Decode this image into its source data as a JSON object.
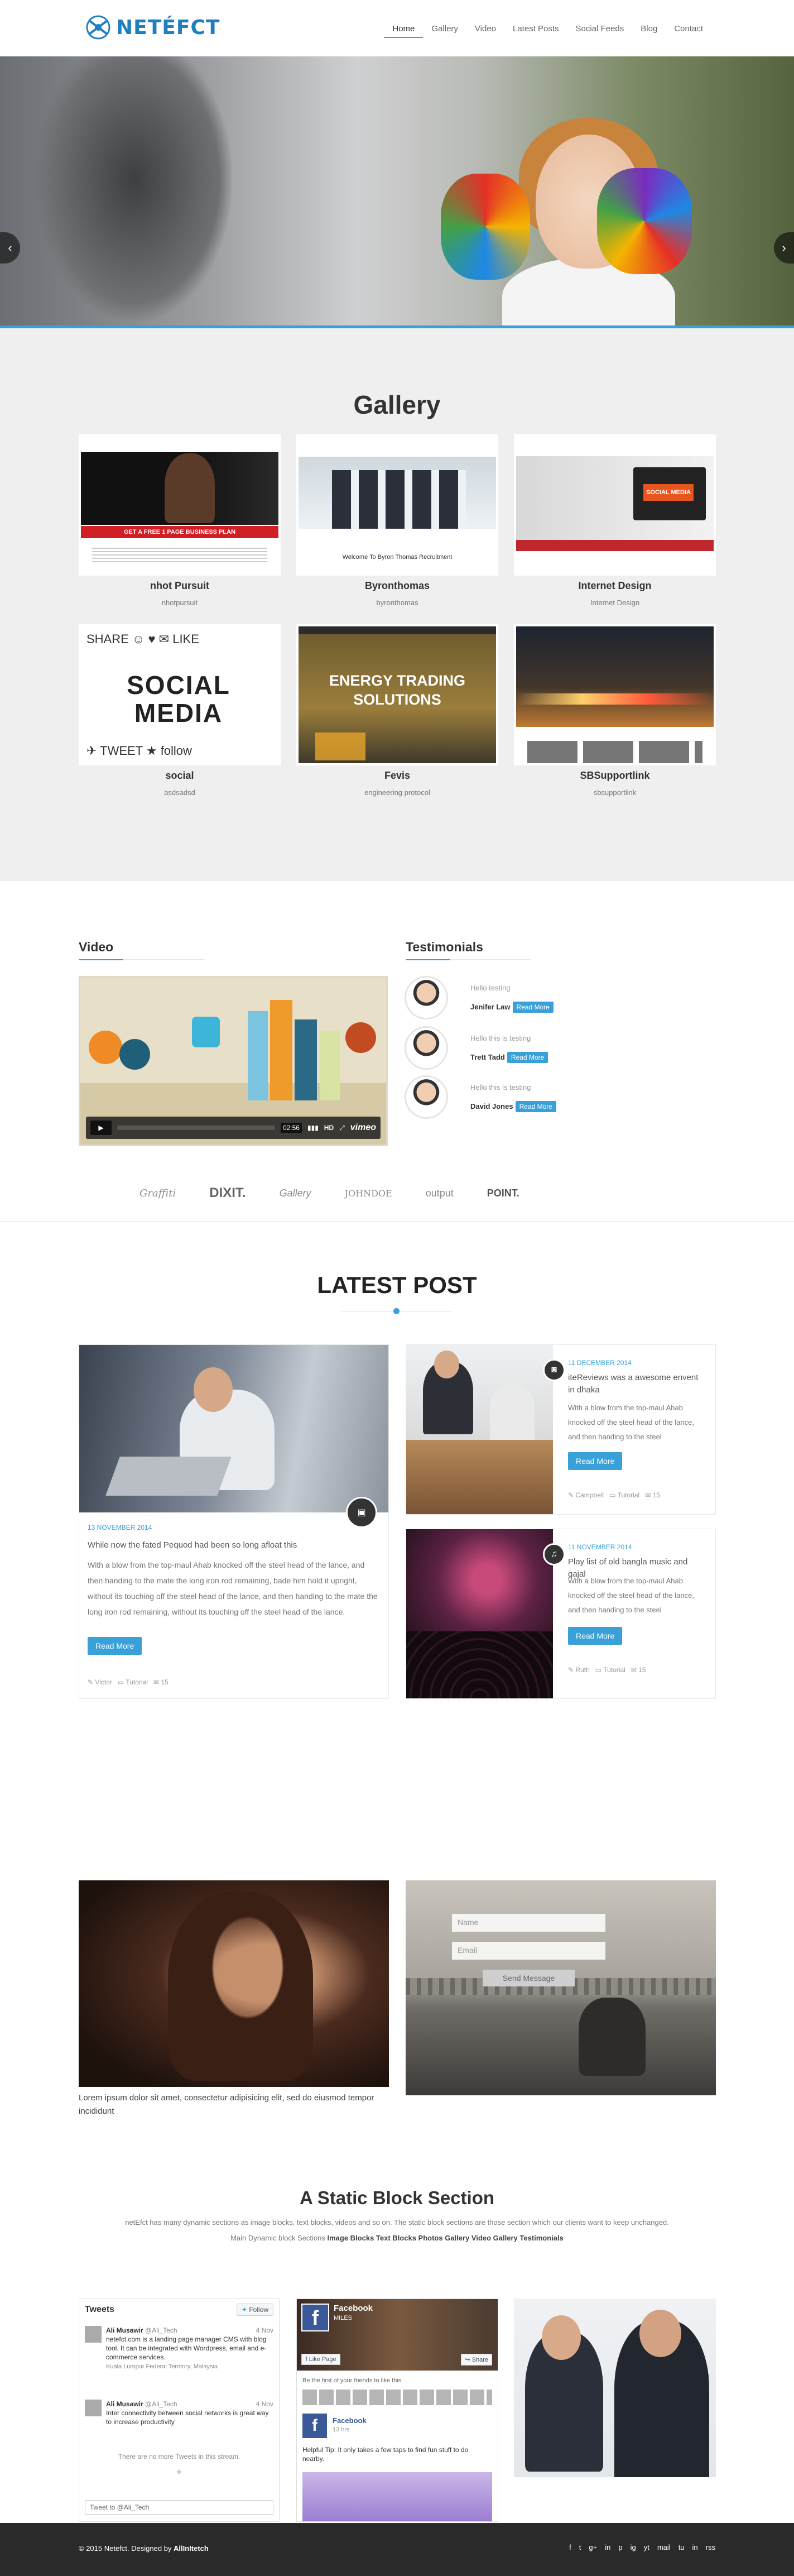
{
  "brand": {
    "name": "NETÉFCT"
  },
  "nav": [
    "Home",
    "Gallery",
    "Video",
    "Latest Posts",
    "Social Feeds",
    "Blog",
    "Contact"
  ],
  "hero": {
    "prev": "‹",
    "next": "›"
  },
  "gallery": {
    "title": "Gallery",
    "items": [
      {
        "title": "nhot Pursuit",
        "sub": "nhotpursuit"
      },
      {
        "title": "Byronthomas",
        "sub": "byronthomas"
      },
      {
        "title": "Internet Design",
        "sub": "Internet Design"
      },
      {
        "title": "social",
        "sub": "asdsadsd"
      },
      {
        "title": "Fevis",
        "sub": "engineering protocol"
      },
      {
        "title": "SBSupportlink",
        "sub": "sbsupportlink"
      }
    ],
    "thumb_text": {
      "energy": "ENERGY TRADING SOLUTIONS",
      "social": "SOCIAL MEDIA",
      "byron": "Welcome To Byron Thomas Recruitment",
      "nhot": "GET A FREE 1 PAGE BUSINESS PLAN"
    }
  },
  "video": {
    "title": "Video",
    "time": "02:56",
    "brand": "vimeo",
    "hd": "HD"
  },
  "testimonials": {
    "title": "Testimonials",
    "items": [
      {
        "text": "Hello testing",
        "name": "Jenifer Law",
        "btn": "Read More"
      },
      {
        "text": "Hello this is testing",
        "name": "Trett Tadd",
        "btn": "Read More"
      },
      {
        "text": "Hello this is testing",
        "name": "David Jones",
        "btn": "Read More"
      }
    ]
  },
  "brands": [
    "Graffiti",
    "DIXIT.",
    "Gallery",
    "JOHNDOE",
    "output",
    "POINT."
  ],
  "latest": {
    "title": "LATEST POST",
    "main": {
      "date": "13 NOVEMBER 2014",
      "title": "While now the fated Pequod had been so long afloat this",
      "body": "With a blow from the top-maul Ahab knocked off the steel head of the lance, and then handing to the mate the long iron rod remaining, bade him hold it upright, without its touching off the steel head of the lance, and then handing to the mate the long iron rod remaining, without its touching off the steel head of the lance.",
      "btn": "Read More",
      "author": "Victor",
      "cat": "Tutorial",
      "comments": "15"
    },
    "side": [
      {
        "date": "11 DECEMBER 2014",
        "title": "iteReviews was a awesome envent in dhaka",
        "body": "With a blow from the top-maul Ahab knocked off the steel head of the lance, and then handing to the steel",
        "btn": "Read More",
        "author": "Campbell",
        "cat": "Tutorial",
        "comments": "15"
      },
      {
        "date": "11 NOVEMBER 2014",
        "title": "Play list of old bangla music and gajal",
        "body": "With a blow from the top-maul Ahab knocked off the steel head of the lance, and then handing to the steel",
        "btn": "Read More",
        "author": "Ruth",
        "cat": "Tutorial",
        "comments": "15"
      }
    ]
  },
  "promo": {
    "caption": "Lorem ipsum dolor sit amet, consectetur adipisicing elit, sed do eiusmod tempor incididunt",
    "name_ph": "Name",
    "email_ph": "Email",
    "send": "Send Message"
  },
  "static": {
    "title": "A Static Block Section",
    "line1": "netEfct has many dynamic sections as image blocks, text blocks, videos and so on. The static block sections are those section which our clients want to keep unchanged.",
    "line2a": "Main Dynamic block Sections ",
    "line2b": "Image Blocks Text Blocks Photos Gallery Video Gallery Testimonials"
  },
  "tweets": {
    "title": "Tweets",
    "follow": "Follow",
    "items": [
      {
        "name": "Ali Musawir",
        "handle": "@Ali_Tech",
        "time": "4 Nov",
        "text": "netefct.com is a landing page manager CMS with blog tool. It can be integrated with Wordpress, email and e-commerce services.",
        "loc": "Kuala Lumpur Federal Territory, Malaysia"
      },
      {
        "name": "Ali Musawir",
        "handle": "@Ali_Tech",
        "time": "4 Nov",
        "text": "Inter connectivity between social networks is great way to increase productivity"
      }
    ],
    "none": "There are no more Tweets in this stream.",
    "reply": "Tweet to @Ali_Tech"
  },
  "facebook": {
    "page": "Facebook",
    "likes": "MILES",
    "like_btn": "Like Page",
    "share": "Share",
    "friends": "Be the first of your friends to like this",
    "post_name": "Facebook",
    "post_time": "13 hrs",
    "post_text": "Helpful Tip: It only takes a few taps to find fun stuff to do nearby."
  },
  "footer": {
    "copy": "© 2015 Netefct. Designed by ",
    "designer": "AllInItetch",
    "icons": [
      "f",
      "t",
      "g+",
      "in",
      "p",
      "ig",
      "yt",
      "mail",
      "tu",
      "in",
      "rss"
    ]
  }
}
